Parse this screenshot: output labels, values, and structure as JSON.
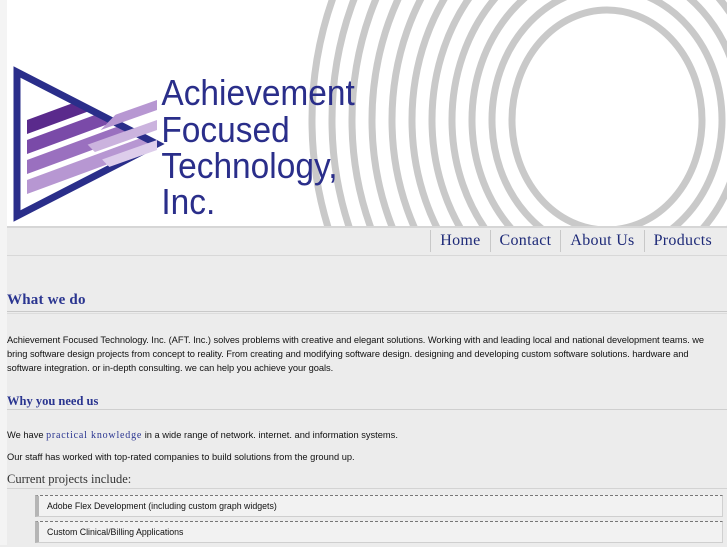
{
  "brand": {
    "name_lines": [
      "Achievement",
      "Focused",
      "Technology,",
      "Inc."
    ],
    "colors": {
      "navy": "#1e2a78",
      "purple": "#6b2d9a",
      "ring_gray": "#c8c8c8"
    }
  },
  "nav": {
    "items": [
      {
        "label": "Home"
      },
      {
        "label": "Contact"
      },
      {
        "label": "About Us"
      },
      {
        "label": "Products"
      }
    ]
  },
  "sections": {
    "what": {
      "heading": "What we do",
      "body": "Achievement Focused Technology. Inc. (AFT. Inc.) solves problems with creative and elegant solutions. Working with and leading local and national development teams. we bring software design projects from concept to reality. From creating and modifying software design. designing and developing custom software solutions. hardware and software integration. or in-depth consulting. we can help you achieve your goals."
    },
    "why": {
      "heading": "Why you need us",
      "line1_before": "We have ",
      "line1_keyword": "practical knowledge",
      "line1_after": " in a wide range of network. internet. and information systems.",
      "line2": "Our staff has worked with top-rated companies to build solutions from the ground up."
    },
    "current": {
      "heading": "Current projects include:",
      "projects": [
        "Adobe Flex Development (including custom graph widgets)",
        "Custom Clinical/Billing Applications"
      ]
    }
  }
}
